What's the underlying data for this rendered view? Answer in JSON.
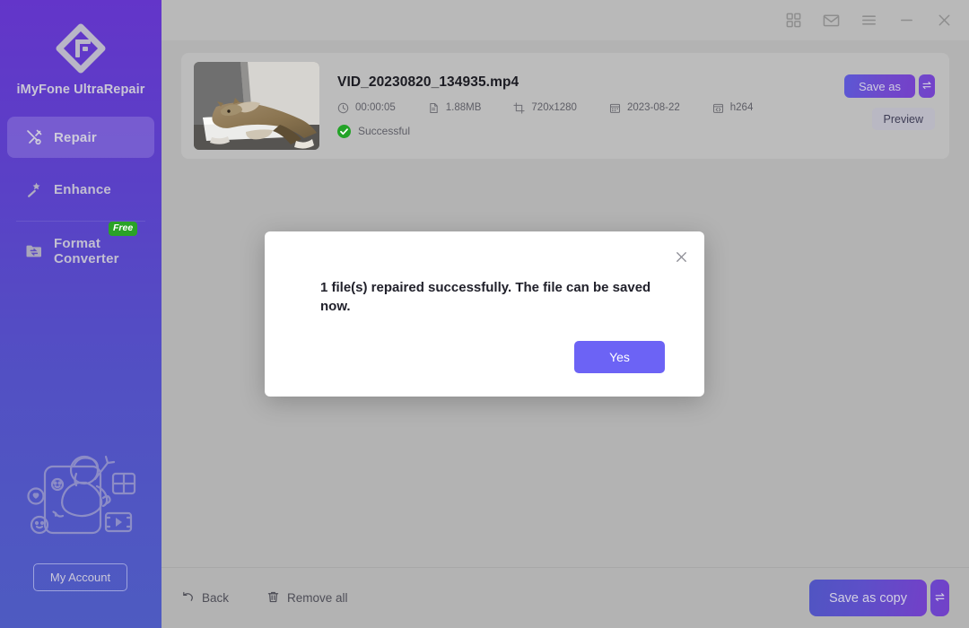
{
  "app": {
    "brand": "iMyFone UltraRepair",
    "logo_icon": "imyfone-diamond-logo"
  },
  "titlebar": {
    "buttons": [
      {
        "name": "apps-grid",
        "icon": "grid-icon",
        "label": ""
      },
      {
        "name": "mail",
        "icon": "envelope-icon",
        "label": ""
      },
      {
        "name": "menu",
        "icon": "hamburger-menu-icon",
        "label": ""
      },
      {
        "name": "minimize",
        "icon": "minimize-icon",
        "label": ""
      },
      {
        "name": "close",
        "icon": "close-icon",
        "label": ""
      }
    ]
  },
  "sidebar": {
    "items": [
      {
        "label": "Repair",
        "icon": "tools-icon",
        "active": true,
        "badge": ""
      },
      {
        "label": "Enhance",
        "icon": "magic-wand-icon",
        "active": false,
        "badge": ""
      },
      {
        "label": "Format Converter",
        "icon": "folder-swap-icon",
        "active": false,
        "badge": "Free"
      }
    ],
    "illustration_icon": "person-in-screen-illustration",
    "account_button": "My Account"
  },
  "file": {
    "name": "VID_20230820_134935.mp4",
    "thumbnail_icon": "cat-on-styrofoam-thumbnail",
    "meta": [
      {
        "icon": "clock-icon",
        "value": "00:00:05"
      },
      {
        "icon": "document-icon",
        "value": "1.88MB"
      },
      {
        "icon": "crop-frame-icon",
        "value": "720x1280"
      },
      {
        "icon": "calendar-icon",
        "value": "2023-08-22"
      },
      {
        "icon": "codec-icon",
        "value": "h264"
      }
    ],
    "status": "Successful",
    "status_icon": "check-circle-icon",
    "status_color": "#23a327",
    "save_as_label": "Save as",
    "save_as_dropdown_icon": "swap-arrows-icon",
    "preview_label": "Preview"
  },
  "bottombar": {
    "back_label": "Back",
    "back_icon": "undo-arrow-icon",
    "remove_all_label": "Remove all",
    "remove_all_icon": "trash-icon",
    "save_copy_label": "Save as copy",
    "save_copy_dropdown_icon": "swap-arrows-icon"
  },
  "modal": {
    "message": "1 file(s) repaired successfully. The file can be saved now.",
    "confirm_label": "Yes",
    "close_icon": "close-icon",
    "confirm_color": "#6c63f5"
  },
  "colors": {
    "sidebar_top": "#6335c9",
    "sidebar_bottom": "#4e5bc1",
    "accent": "#6c63f5",
    "background": "#b3b3b3",
    "success": "#23a327",
    "free_badge": "#2aa226"
  }
}
